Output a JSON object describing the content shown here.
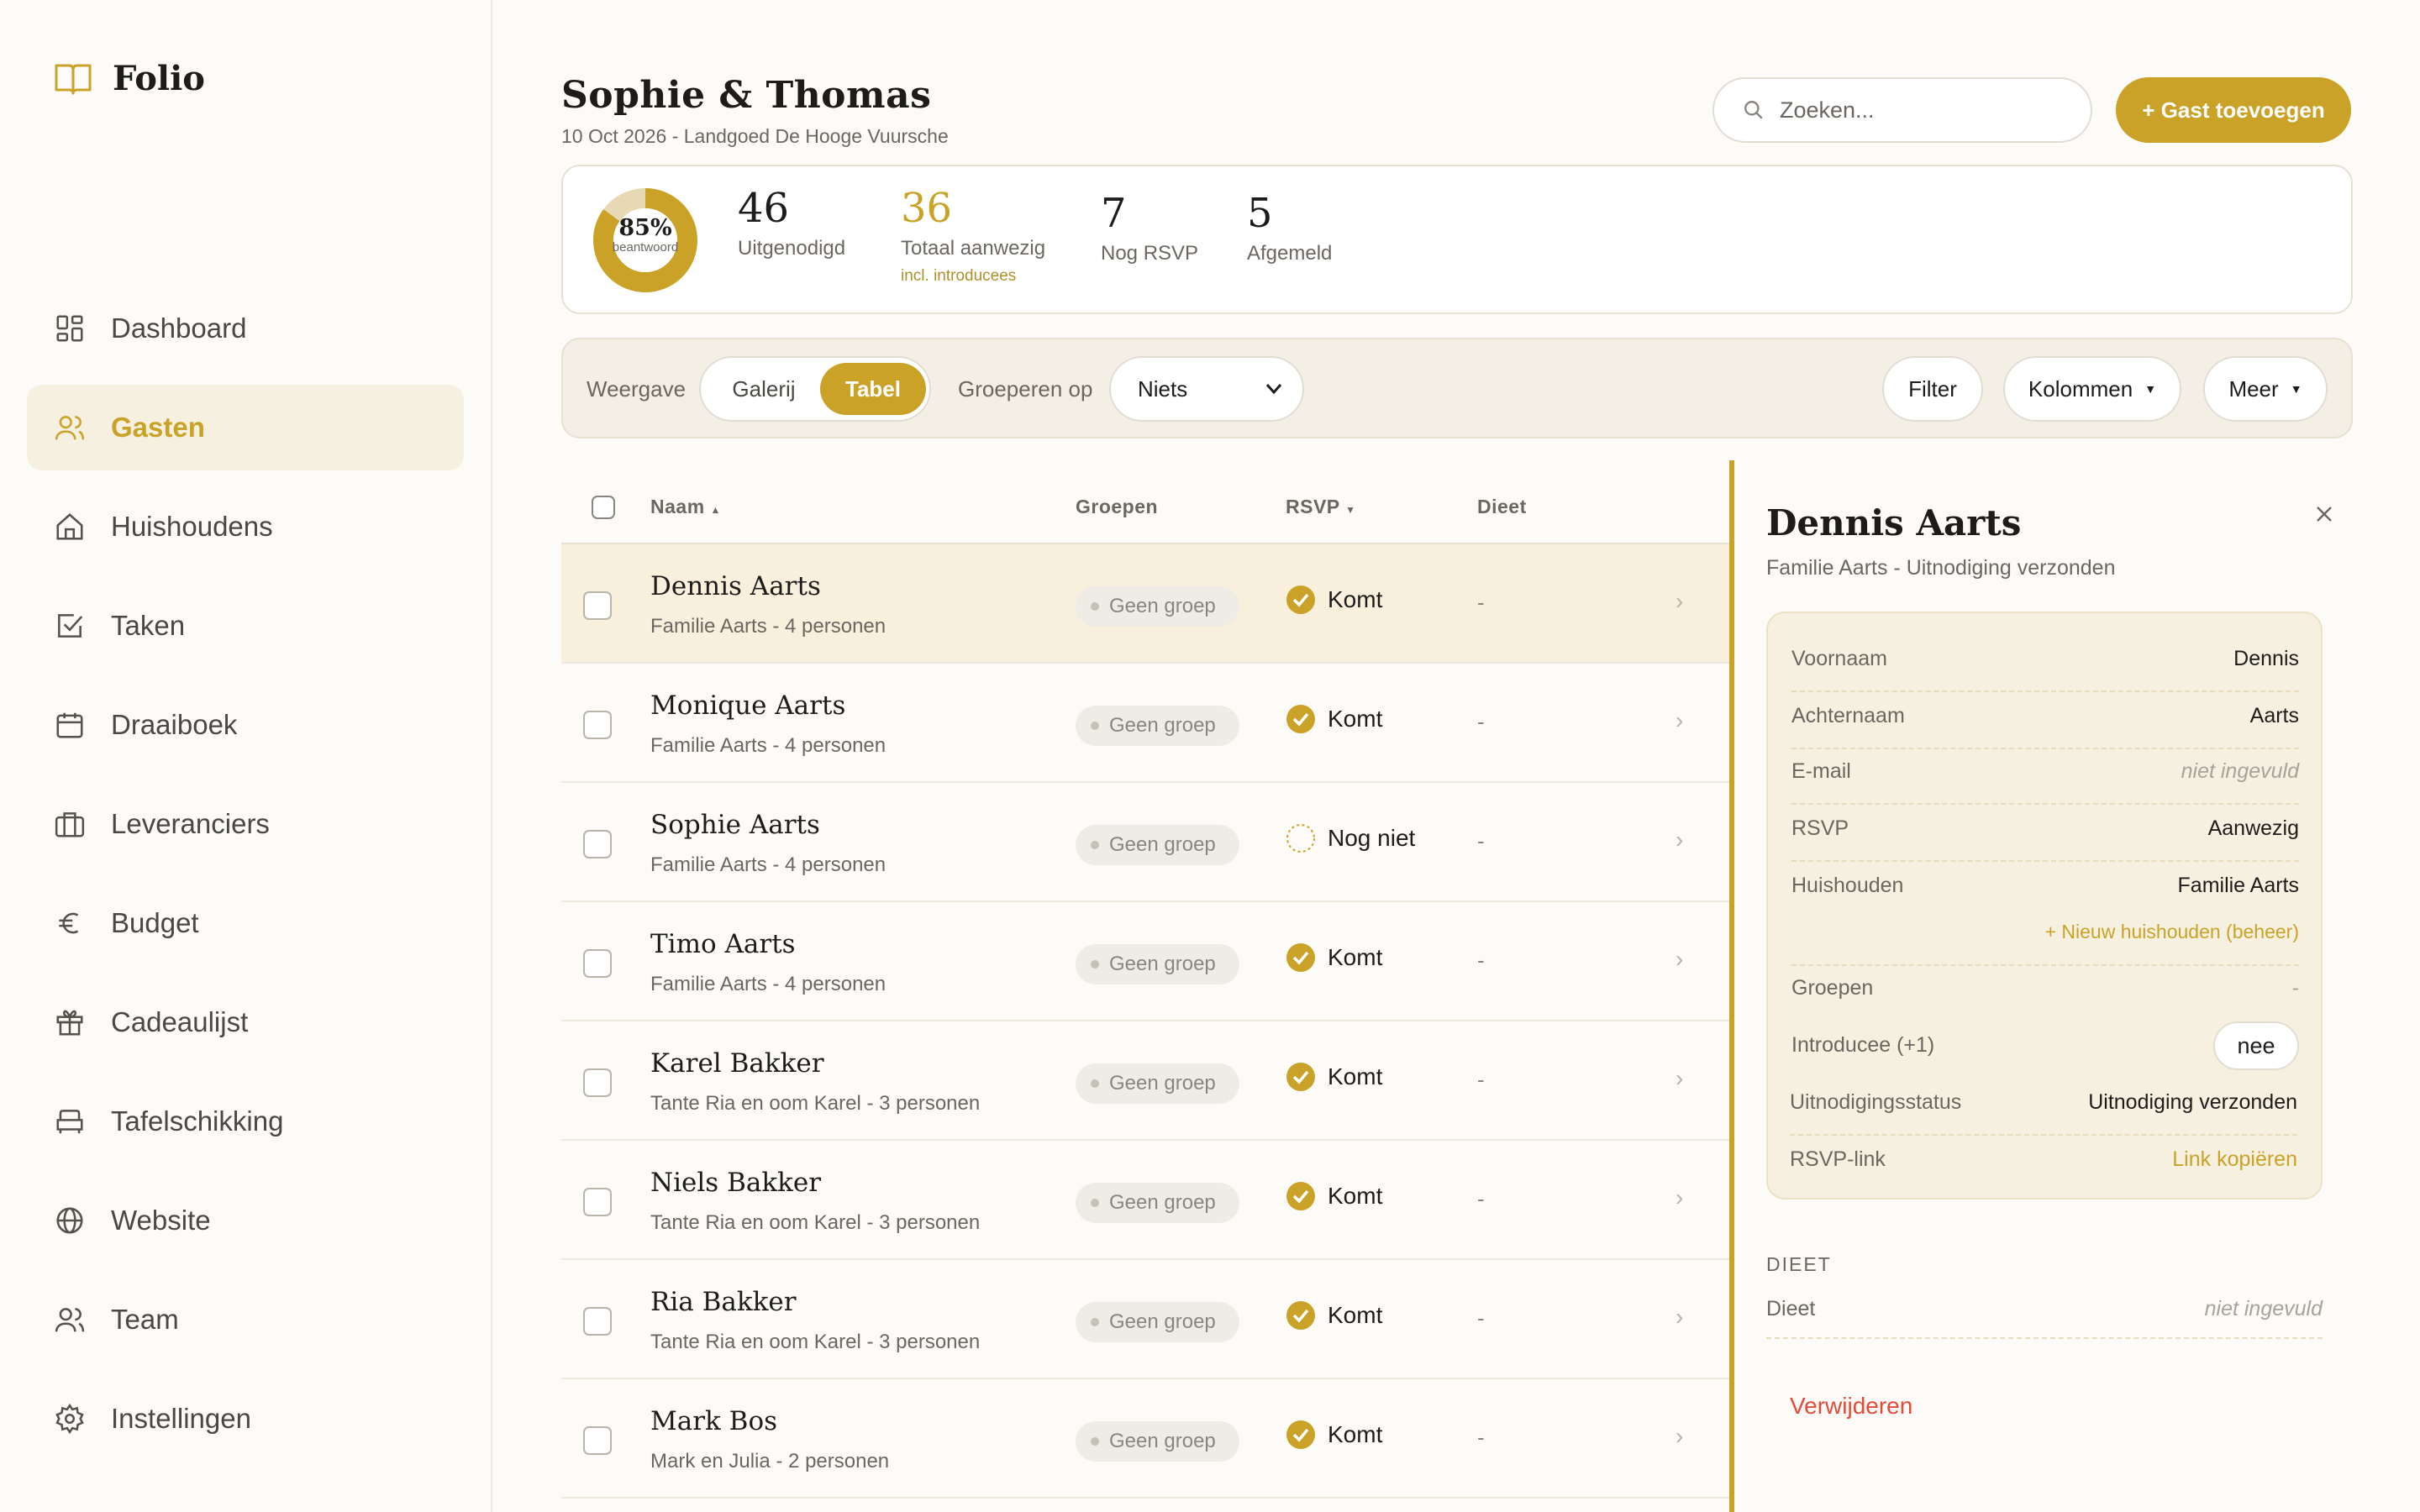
{
  "brand": {
    "name": "Folio"
  },
  "sidebar": {
    "items": [
      {
        "label": "Dashboard",
        "icon": "dashboard-icon"
      },
      {
        "label": "Gasten",
        "icon": "users-icon",
        "active": true
      },
      {
        "label": "Huishoudens",
        "icon": "home-icon"
      },
      {
        "label": "Taken",
        "icon": "checkbox-icon"
      },
      {
        "label": "Draaiboek",
        "icon": "calendar-icon"
      },
      {
        "label": "Leveranciers",
        "icon": "briefcase-icon"
      },
      {
        "label": "Budget",
        "icon": "euro-icon"
      },
      {
        "label": "Cadeaulijst",
        "icon": "gift-icon"
      },
      {
        "label": "Tafelschikking",
        "icon": "sofa-icon"
      },
      {
        "label": "Website",
        "icon": "globe-icon"
      },
      {
        "label": "Team",
        "icon": "team-icon"
      },
      {
        "label": "Instellingen",
        "icon": "gear-icon"
      }
    ]
  },
  "header": {
    "title": "Sophie & Thomas",
    "subtitle": "10 Oct 2026 - Landgoed De Hooge Vuursche",
    "search_placeholder": "Zoeken...",
    "add_button": "+ Gast toevoegen"
  },
  "stats": {
    "donut_pct": "85%",
    "donut_fraction": 0.85,
    "donut_label": "beantwoord",
    "invited": {
      "value": "46",
      "label": "Uitgenodigd"
    },
    "present": {
      "value": "36",
      "label": "Totaal aanwezig",
      "note": "incl. introducees"
    },
    "pending": {
      "value": "7",
      "label": "Nog RSVP"
    },
    "declined": {
      "value": "5",
      "label": "Afgemeld"
    }
  },
  "toolbar": {
    "view_label": "Weergave",
    "view_options": [
      "Galerij",
      "Tabel"
    ],
    "view_selected": "Tabel",
    "group_label": "Groeperen op",
    "group_value": "Niets",
    "filter": "Filter",
    "columns": "Kolommen",
    "more": "Meer"
  },
  "table": {
    "columns": {
      "name": "Naam",
      "groups": "Groepen",
      "rsvp": "RSVP",
      "diet": "Dieet"
    },
    "rows": [
      {
        "name": "Dennis Aarts",
        "sub": "Familie Aarts - 4 personen",
        "group": "Geen groep",
        "rsvp": "Komt",
        "diet": "-",
        "selected": true
      },
      {
        "name": "Monique Aarts",
        "sub": "Familie Aarts - 4 personen",
        "group": "Geen groep",
        "rsvp": "Komt",
        "diet": "-"
      },
      {
        "name": "Sophie Aarts",
        "sub": "Familie Aarts - 4 personen",
        "group": "Geen groep",
        "rsvp": "Nog niet",
        "diet": "-"
      },
      {
        "name": "Timo Aarts",
        "sub": "Familie Aarts - 4 personen",
        "group": "Geen groep",
        "rsvp": "Komt",
        "diet": "-"
      },
      {
        "name": "Karel Bakker",
        "sub": "Tante Ria en oom Karel - 3 personen",
        "group": "Geen groep",
        "rsvp": "Komt",
        "diet": "-"
      },
      {
        "name": "Niels Bakker",
        "sub": "Tante Ria en oom Karel - 3 personen",
        "group": "Geen groep",
        "rsvp": "Komt",
        "diet": "-"
      },
      {
        "name": "Ria Bakker",
        "sub": "Tante Ria en oom Karel - 3 personen",
        "group": "Geen groep",
        "rsvp": "Komt",
        "diet": "-"
      },
      {
        "name": "Mark Bos",
        "sub": "Mark en Julia - 2 personen",
        "group": "Geen groep",
        "rsvp": "Komt",
        "diet": "-"
      }
    ]
  },
  "panel": {
    "title": "Dennis Aarts",
    "subtitle": "Familie Aarts - Uitnodiging verzonden",
    "fields": {
      "voornaam": {
        "label": "Voornaam",
        "value": "Dennis"
      },
      "achternaam": {
        "label": "Achternaam",
        "value": "Aarts"
      },
      "email": {
        "label": "E-mail",
        "value": "niet ingevuld"
      },
      "rsvp": {
        "label": "RSVP",
        "value": "Aanwezig"
      },
      "huishouden": {
        "label": "Huishouden",
        "value": "Familie Aarts",
        "link": "+ Nieuw huishouden (beheer)"
      },
      "groepen": {
        "label": "Groepen",
        "value": "-"
      },
      "introducee": {
        "label": "Introducee (+1)",
        "value": "nee"
      },
      "status": {
        "label": "Uitnodigingsstatus",
        "value": "Uitnodiging verzonden"
      },
      "rsvp_link": {
        "label": "RSVP-link",
        "value": "Link kopiëren"
      }
    },
    "diet_section": "DIEET",
    "diet_label": "Dieet",
    "diet_value": "niet ingevuld",
    "delete": "Verwijderen"
  },
  "colors": {
    "accent": "#c9a227",
    "accent_soft": "#f6f0e0",
    "danger": "#e04b3a",
    "text": "#1d1c1a",
    "muted": "#6b6760"
  }
}
